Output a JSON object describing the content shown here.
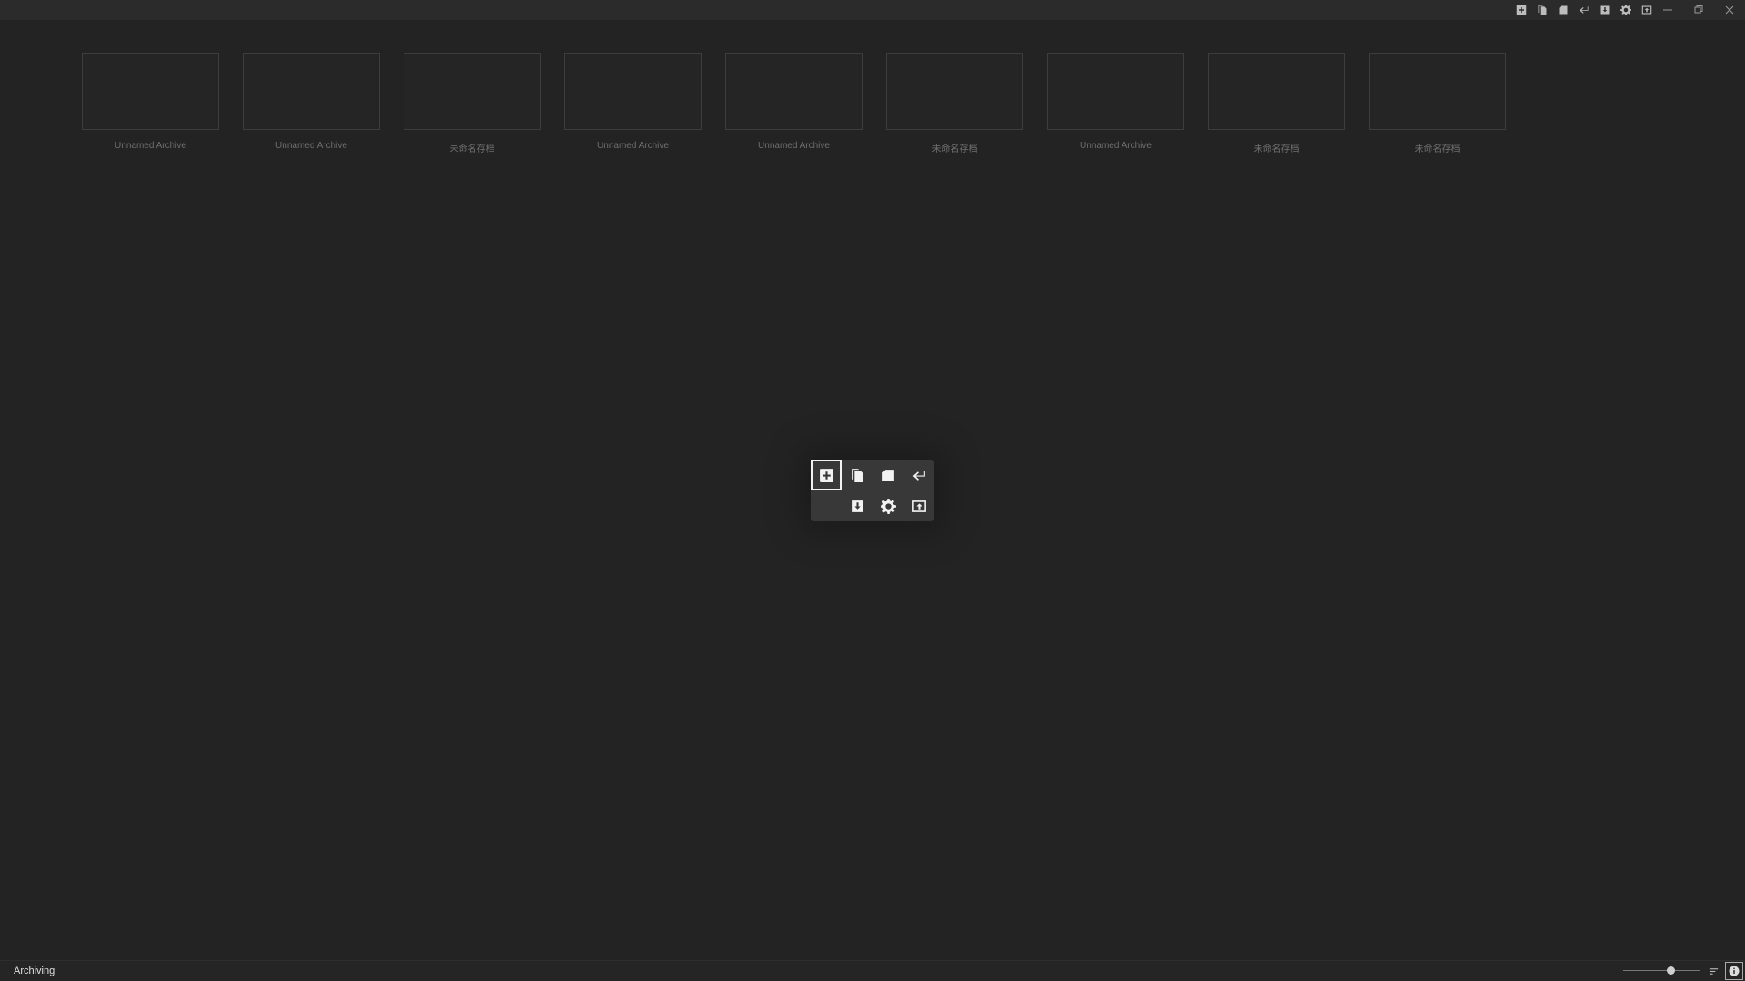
{
  "titlebar": {
    "tools": [
      {
        "name": "new-icon"
      },
      {
        "name": "copy-icon"
      },
      {
        "name": "save-icon"
      },
      {
        "name": "undo-icon"
      },
      {
        "name": "load-icon"
      },
      {
        "name": "gear-icon"
      },
      {
        "name": "export-icon"
      }
    ],
    "controls": [
      "minimize",
      "restore",
      "close"
    ]
  },
  "archives": [
    {
      "label": "Unnamed Archive"
    },
    {
      "label": "Unnamed Archive"
    },
    {
      "label": "未命名存档"
    },
    {
      "label": "Unnamed Archive"
    },
    {
      "label": "Unnamed Archive"
    },
    {
      "label": "未命名存档"
    },
    {
      "label": "Unnamed Archive"
    },
    {
      "label": "未命名存档"
    },
    {
      "label": "未命名存档"
    }
  ],
  "palette": {
    "row1": [
      "new-icon",
      "copy-icon",
      "save-icon",
      "undo-icon"
    ],
    "row2": [
      "",
      "load-icon",
      "gear-icon",
      "export-icon"
    ],
    "selected": "new-icon"
  },
  "statusbar": {
    "text": "Archiving",
    "zoom_fraction": 0.62
  },
  "colors": {
    "background": "#232323",
    "titlebar": "#2b2b2b",
    "palette_bg": "#383838",
    "label": "#6f6f6f"
  }
}
